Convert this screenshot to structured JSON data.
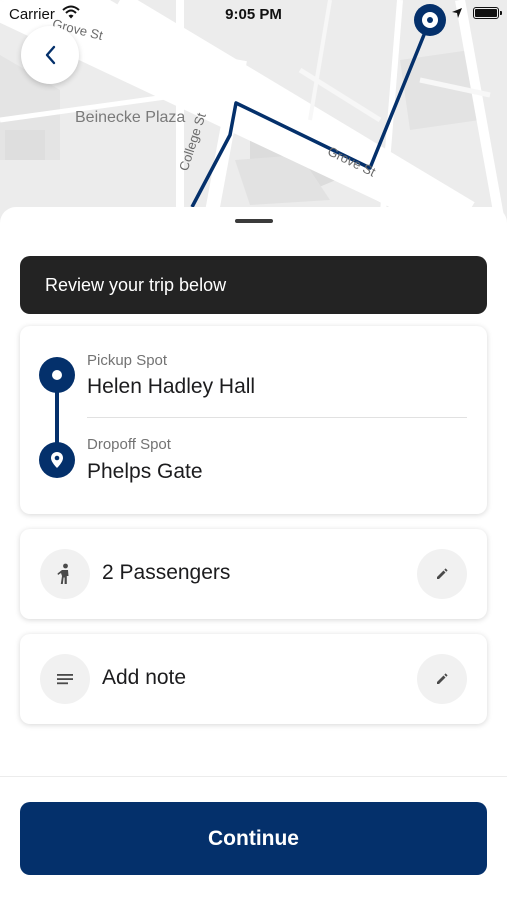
{
  "status_bar": {
    "carrier": "Carrier",
    "time": "9:05 PM"
  },
  "map": {
    "labels": {
      "grove_st_top": "Grove St",
      "beinecke_plaza": "Beinecke Plaza",
      "college_st": "College St",
      "grove_st_mid": "Grove St"
    },
    "route_color": "#04306b"
  },
  "sheet": {
    "banner": "Review your trip below",
    "trip": {
      "pickup_label": "Pickup Spot",
      "pickup_value": "Helen Hadley Hall",
      "dropoff_label": "Dropoff Spot",
      "dropoff_value": "Phelps Gate"
    },
    "passengers": {
      "icon": "person-icon",
      "text": "2 Passengers",
      "edit_icon": "pencil-icon"
    },
    "note": {
      "icon": "notes-icon",
      "text": "Add note",
      "edit_icon": "pencil-icon"
    },
    "continue_label": "Continue"
  },
  "colors": {
    "primary": "#04306b",
    "banner_bg": "#232323"
  }
}
